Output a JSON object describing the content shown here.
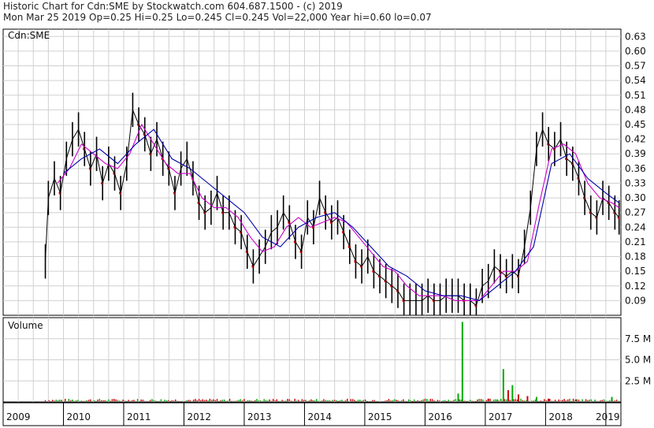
{
  "header": {
    "line1": "Historic Chart for Cdn:SME by Stockwatch.com 604.687.1500 - (c) 2019",
    "line2": "Mon Mar 25 2019  Op=0.25  Hi=0.25  Lo=0.245  Cl=0.245  Vol=22,000  Year hi=0.60  lo=0.07"
  },
  "colors": {
    "price_bar": "#000000",
    "down_tick": "#cc0000",
    "ma_short": "#cc00cc",
    "ma_long": "#0000aa",
    "volume_up": "#00aa00",
    "volume_down": "#cc0000",
    "grid": "#d0d0d0",
    "frame": "#000000"
  },
  "chart_data": [
    {
      "type": "line",
      "title": "Cdn:SME",
      "ylim": [
        0.06,
        0.645
      ],
      "y_ticks": [
        "0.63",
        "0.60",
        "0.57",
        "0.54",
        "0.51",
        "0.48",
        "0.45",
        "0.42",
        "0.39",
        "0.36",
        "0.33",
        "0.30",
        "0.27",
        "0.24",
        "0.21",
        "0.18",
        "0.15",
        "0.12",
        "0.09"
      ],
      "x_ticks": [
        "2009",
        "2010",
        "2011",
        "2012",
        "2013",
        "2014",
        "2015",
        "2016",
        "2017",
        "2018",
        "2019"
      ],
      "xlim": [
        2009.0,
        2019.25
      ],
      "series": [
        {
          "x": [
            2009.7,
            2009.75,
            2009.85,
            2009.95,
            2010.05,
            2010.15,
            2010.25,
            2010.35,
            2010.45,
            2010.55,
            2010.65,
            2010.75,
            2010.85,
            2010.95,
            2011.05,
            2011.15,
            2011.25,
            2011.35,
            2011.45,
            2011.55,
            2011.65,
            2011.75,
            2011.85,
            2011.95,
            2012.05,
            2012.15,
            2012.25,
            2012.35,
            2012.45,
            2012.55,
            2012.65,
            2012.75,
            2012.85,
            2012.95,
            2013.05,
            2013.15,
            2013.25,
            2013.35,
            2013.45,
            2013.55,
            2013.65,
            2013.75,
            2013.85,
            2013.95,
            2014.05,
            2014.15,
            2014.25,
            2014.35,
            2014.45,
            2014.55,
            2014.65,
            2014.75,
            2014.85,
            2014.95,
            2015.05,
            2015.15,
            2015.25,
            2015.35,
            2015.45,
            2015.55,
            2015.65,
            2015.75,
            2015.85,
            2015.95,
            2016.05,
            2016.15,
            2016.25,
            2016.35,
            2016.45,
            2016.55,
            2016.65,
            2016.75,
            2016.85,
            2016.95,
            2017.05,
            2017.15,
            2017.25,
            2017.35,
            2017.45,
            2017.55,
            2017.65,
            2017.75,
            2017.85,
            2017.95,
            2018.05,
            2018.15,
            2018.25,
            2018.35,
            2018.45,
            2018.55,
            2018.65,
            2018.75,
            2018.85,
            2018.95,
            2019.05,
            2019.15,
            2019.22
          ],
          "y": [
            0.17,
            0.3,
            0.34,
            0.31,
            0.38,
            0.42,
            0.44,
            0.4,
            0.36,
            0.39,
            0.33,
            0.37,
            0.35,
            0.31,
            0.37,
            0.48,
            0.45,
            0.43,
            0.39,
            0.42,
            0.38,
            0.36,
            0.31,
            0.36,
            0.38,
            0.34,
            0.29,
            0.27,
            0.28,
            0.31,
            0.27,
            0.27,
            0.24,
            0.23,
            0.19,
            0.16,
            0.18,
            0.2,
            0.23,
            0.24,
            0.27,
            0.25,
            0.21,
            0.19,
            0.26,
            0.24,
            0.3,
            0.27,
            0.25,
            0.26,
            0.23,
            0.2,
            0.17,
            0.16,
            0.18,
            0.15,
            0.14,
            0.13,
            0.12,
            0.11,
            0.09,
            0.09,
            0.09,
            0.09,
            0.1,
            0.09,
            0.09,
            0.1,
            0.1,
            0.1,
            0.09,
            0.09,
            0.08,
            0.12,
            0.13,
            0.16,
            0.15,
            0.14,
            0.15,
            0.14,
            0.2,
            0.28,
            0.4,
            0.44,
            0.41,
            0.4,
            0.42,
            0.38,
            0.37,
            0.34,
            0.3,
            0.27,
            0.26,
            0.3,
            0.29,
            0.27,
            0.26
          ]
        },
        {
          "x": [
            2009.9,
            2010.1,
            2010.3,
            2010.5,
            2010.7,
            2010.9,
            2011.1,
            2011.3,
            2011.5,
            2011.7,
            2011.9,
            2012.1,
            2012.3,
            2012.5,
            2012.7,
            2012.9,
            2013.1,
            2013.3,
            2013.5,
            2013.7,
            2013.9,
            2014.1,
            2014.3,
            2014.5,
            2014.7,
            2014.9,
            2015.1,
            2015.3,
            2015.5,
            2015.7,
            2015.9,
            2016.1,
            2016.3,
            2016.5,
            2016.7,
            2016.9,
            2017.1,
            2017.3,
            2017.5,
            2017.7,
            2017.9,
            2018.1,
            2018.3,
            2018.5,
            2018.7,
            2018.9,
            2019.1,
            2019.22
          ],
          "y": [
            0.33,
            0.36,
            0.41,
            0.39,
            0.37,
            0.36,
            0.39,
            0.45,
            0.41,
            0.37,
            0.35,
            0.35,
            0.3,
            0.28,
            0.28,
            0.26,
            0.22,
            0.19,
            0.2,
            0.24,
            0.26,
            0.24,
            0.25,
            0.26,
            0.25,
            0.22,
            0.19,
            0.16,
            0.15,
            0.12,
            0.1,
            0.1,
            0.1,
            0.09,
            0.09,
            0.09,
            0.12,
            0.15,
            0.15,
            0.17,
            0.29,
            0.4,
            0.41,
            0.39,
            0.33,
            0.3,
            0.29,
            0.28
          ]
        },
        {
          "x": [
            2010.0,
            2010.3,
            2010.6,
            2010.9,
            2011.2,
            2011.5,
            2011.8,
            2012.1,
            2012.4,
            2012.7,
            2013.0,
            2013.3,
            2013.6,
            2013.9,
            2014.2,
            2014.5,
            2014.8,
            2015.1,
            2015.4,
            2015.7,
            2016.0,
            2016.3,
            2016.6,
            2016.9,
            2017.2,
            2017.5,
            2017.8,
            2018.1,
            2018.4,
            2018.7,
            2019.0,
            2019.22
          ],
          "y": [
            0.35,
            0.38,
            0.4,
            0.37,
            0.41,
            0.44,
            0.38,
            0.36,
            0.33,
            0.3,
            0.27,
            0.22,
            0.2,
            0.24,
            0.26,
            0.27,
            0.24,
            0.2,
            0.16,
            0.14,
            0.11,
            0.1,
            0.1,
            0.09,
            0.12,
            0.15,
            0.2,
            0.37,
            0.39,
            0.34,
            0.31,
            0.29
          ]
        }
      ]
    },
    {
      "type": "bar",
      "title": "Volume",
      "ylim": [
        0,
        10
      ],
      "y_ticks": [
        "7.5 M",
        "5.0 M",
        "2.5 M"
      ],
      "events": [
        {
          "x": 2016.55,
          "value": 1.0
        },
        {
          "x": 2016.62,
          "value": 9.5
        },
        {
          "x": 2017.05,
          "value": 0.4
        },
        {
          "x": 2017.2,
          "value": 0.3
        },
        {
          "x": 2017.3,
          "value": 3.9
        },
        {
          "x": 2017.38,
          "value": 1.4
        },
        {
          "x": 2017.45,
          "value": 2.0
        },
        {
          "x": 2017.55,
          "value": 0.9
        },
        {
          "x": 2017.7,
          "value": 0.7
        },
        {
          "x": 2017.85,
          "value": 0.6
        },
        {
          "x": 2018.05,
          "value": 0.4
        },
        {
          "x": 2018.5,
          "value": 0.3
        },
        {
          "x": 2019.1,
          "value": 0.6
        }
      ]
    }
  ]
}
